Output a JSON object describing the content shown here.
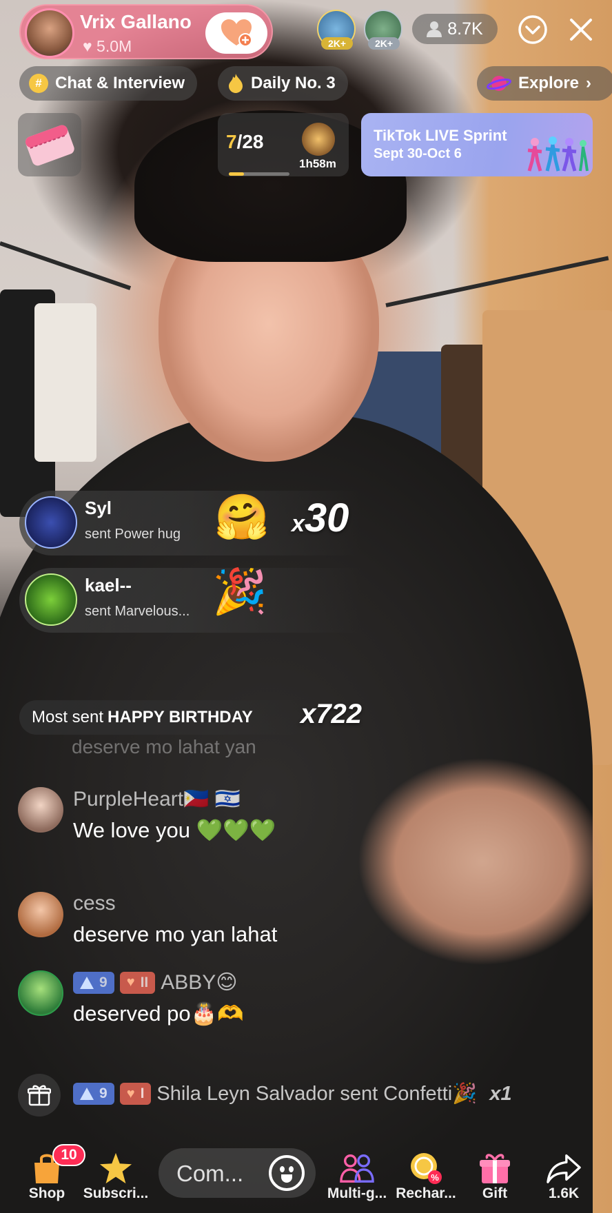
{
  "host": {
    "name": "Vrix Gallano",
    "likes": "5.0M"
  },
  "top_viewers": [
    {
      "badge": "2K+"
    },
    {
      "badge": "2K+"
    }
  ],
  "viewer_count": "8.7K",
  "tags": {
    "chat": "Chat & Interview",
    "daily": "Daily No. 3",
    "explore": "Explore"
  },
  "rank": {
    "current": "7",
    "total": "/28",
    "timer": "1h58m",
    "progress": 0.25
  },
  "sprint": {
    "title": "TikTok LIVE Sprint",
    "dates": "Sept 30-Oct 6"
  },
  "gifts": [
    {
      "user": "Syl",
      "action": "sent Power hug",
      "emoji": "🤗",
      "count_prefix": "x",
      "count": "30"
    },
    {
      "user": "kael--",
      "action": "sent Marvelous...",
      "emoji": "🎉",
      "count_prefix": "",
      "count": ""
    }
  ],
  "most_sent": {
    "prefix": "Most sent",
    "gift": "HAPPY BIRTHDAY",
    "count": "x722"
  },
  "faded_comment": "deserve mo lahat yan",
  "comments": [
    {
      "user": "PurpleHeart🇵🇭 🇮🇱",
      "text": "We love you 💚💚💚"
    },
    {
      "user": "cess",
      "text": "deserve mo yan lahat"
    },
    {
      "user": "ABBY😊",
      "level": "9",
      "fan": "II",
      "text": "deserved po🎂🫶"
    }
  ],
  "system_message": {
    "level": "9",
    "fan": "I",
    "text": "Shila Leyn Salvador sent Confetti🎉",
    "count": "x1"
  },
  "bottom_bar": {
    "shop": "Shop",
    "shop_badge": "10",
    "subscribe": "Subscri...",
    "comment_placeholder": "Com...",
    "multi_guest": "Multi-g...",
    "recharge": "Rechar...",
    "gift": "Gift",
    "share_count": "1.6K"
  }
}
